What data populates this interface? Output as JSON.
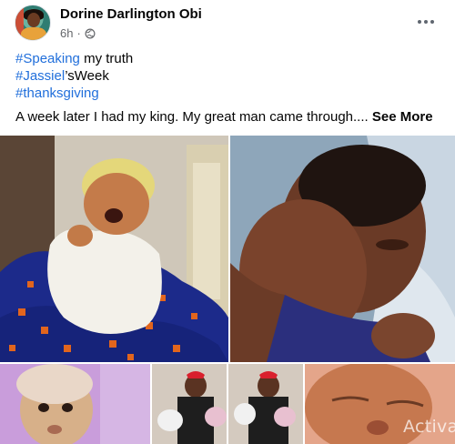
{
  "post": {
    "author_name": "Dorine Darlington Obi",
    "timestamp": "6h",
    "separator": "·",
    "privacy_icon": "globe-icon",
    "more_icon": "more-horizontal-icon",
    "hashtags": {
      "speaking": "#Speaking",
      "speaking_rest": " my truth",
      "jassiel": "#Jassiel",
      "jassiel_rest": "’sWeek",
      "thanksgiving": "#thanksgiving"
    },
    "body": "A week later I had my king. My great man came through.... ",
    "see_more_label": "See More"
  },
  "photos": [
    {
      "name": "photo-newborn-yawning"
    },
    {
      "name": "photo-baby-sleeping"
    },
    {
      "name": "photo-baby-face"
    },
    {
      "name": "photo-mother-with-twins"
    },
    {
      "name": "photo-baby-closeup"
    }
  ],
  "overlay": {
    "watermark": "Activat"
  },
  "colors": {
    "hashtag": "#216fdb",
    "meta_text": "#65676b",
    "text": "#050505"
  }
}
